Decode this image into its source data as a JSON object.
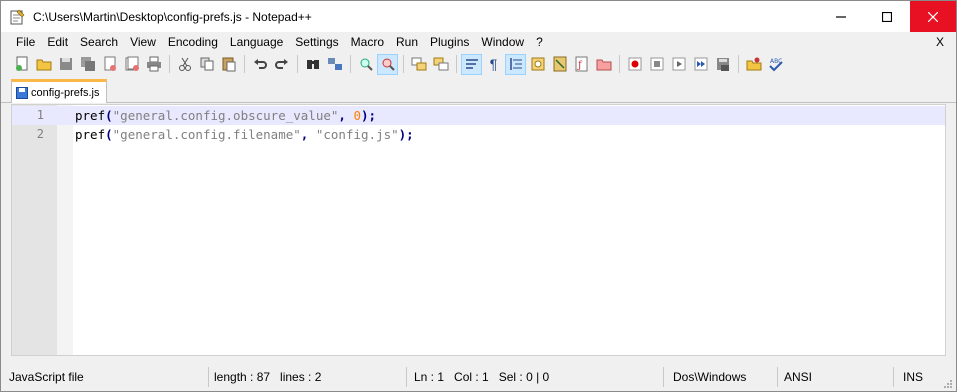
{
  "window": {
    "title": "C:\\Users\\Martin\\Desktop\\config-prefs.js - Notepad++"
  },
  "menubar": {
    "items": [
      {
        "label": "File"
      },
      {
        "label": "Edit"
      },
      {
        "label": "Search"
      },
      {
        "label": "View"
      },
      {
        "label": "Encoding"
      },
      {
        "label": "Language"
      },
      {
        "label": "Settings"
      },
      {
        "label": "Macro"
      },
      {
        "label": "Run"
      },
      {
        "label": "Plugins"
      },
      {
        "label": "Window"
      },
      {
        "label": "?"
      }
    ],
    "close_label": "X"
  },
  "tabs": [
    {
      "label": "config-prefs.js",
      "icon": "save-icon"
    }
  ],
  "editor": {
    "lines": [
      {
        "num": "1",
        "fn": "pref",
        "open": "(",
        "arg1": "\"general.config.obscure_value\"",
        "sep": ", ",
        "arg2": "0",
        "close": ");"
      },
      {
        "num": "2",
        "fn": "pref",
        "open": "(",
        "arg1": "\"general.config.filename\"",
        "sep": ", ",
        "arg2": "\"config.js\"",
        "close": ");"
      }
    ]
  },
  "statusbar": {
    "file_type": "JavaScript file",
    "length": "length : 87",
    "lines": "lines : 2",
    "ln": "Ln : 1",
    "col": "Col : 1",
    "sel": "Sel : 0 | 0",
    "eol": "Dos\\Windows",
    "encoding": "ANSI",
    "mode": "INS"
  },
  "colors": {
    "close_button": "#e81123",
    "tab_accent": "#fab848",
    "current_line": "#e8e8ff"
  }
}
